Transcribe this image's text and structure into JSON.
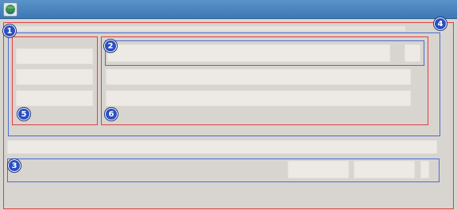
{
  "window": {
    "icon": "globe-app-icon",
    "colors": {
      "titlebar": "#4a86c0",
      "background": "#d8d4cf",
      "field": "#ede9e5",
      "highlight_red": "#e04040",
      "highlight_blue": "#4a6ed0",
      "badge": "#2b4fc2"
    }
  },
  "annotations": {
    "badge_1": "1",
    "badge_2": "2",
    "badge_3": "3",
    "badge_4": "4",
    "badge_5": "5",
    "badge_6": "6"
  }
}
